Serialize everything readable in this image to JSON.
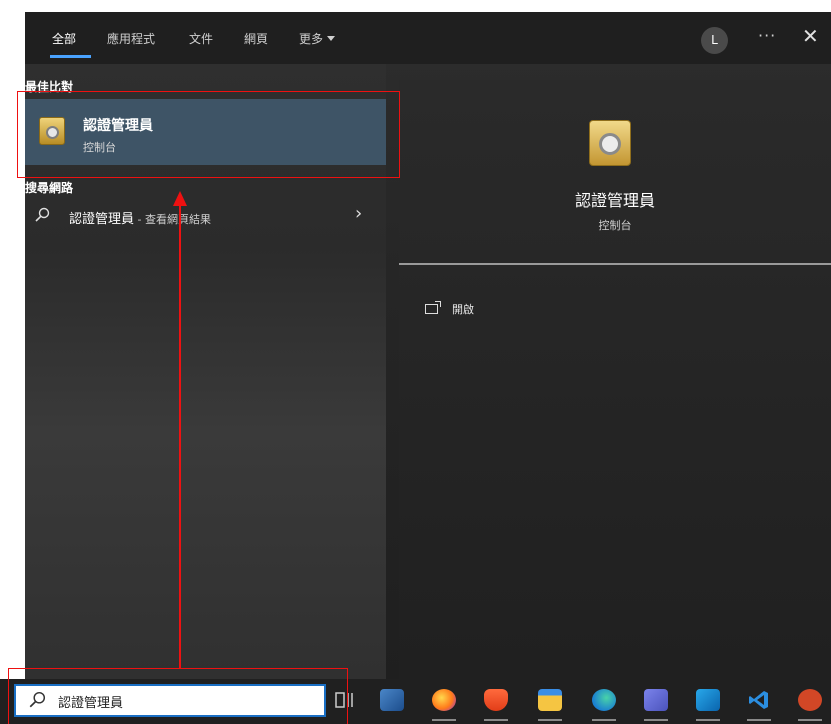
{
  "tabs": [
    {
      "label": "全部",
      "active": true
    },
    {
      "label": "應用程式",
      "active": false
    },
    {
      "label": "文件",
      "active": false
    },
    {
      "label": "網頁",
      "active": false
    },
    {
      "label": "更多",
      "active": false
    }
  ],
  "header": {
    "avatar_initial": "L",
    "more_label": "···",
    "close_label": "✕"
  },
  "results": {
    "best_match_heading": "最佳比對",
    "best_match": {
      "title": "認證管理員",
      "subtitle": "控制台",
      "icon": "safe-icon"
    },
    "web_heading": "搜尋網路",
    "web_item": {
      "query": "認證管理員",
      "suffix": " - 查看網頁結果",
      "chevron": "›"
    }
  },
  "preview": {
    "title": "認證管理員",
    "subtitle": "控制台",
    "open_label": "開啟"
  },
  "taskbar": {
    "search_value": "認證管理員",
    "icons": [
      "task-view-icon",
      "remote-desktop-icon",
      "firefox-icon",
      "brave-icon",
      "file-explorer-icon",
      "edge-icon",
      "teams-icon",
      "outlook-icon",
      "vscode-icon",
      "powerpoint-icon"
    ]
  },
  "colors": {
    "accent": "#4aa3ff",
    "selection": "#3e5466",
    "annotation": "#e11111"
  }
}
